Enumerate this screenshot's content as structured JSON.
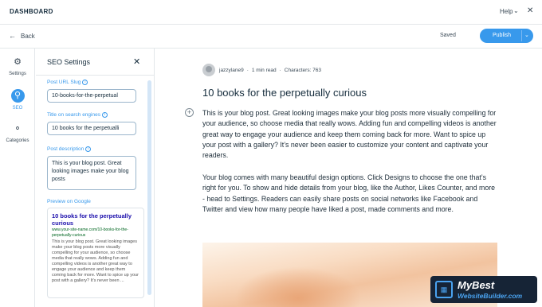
{
  "topbar": {
    "title": "DASHBOARD",
    "help": "Help"
  },
  "secondbar": {
    "back": "Back",
    "saved": "Saved",
    "publish": "Publish"
  },
  "rail": {
    "settings": "Settings",
    "seo": "SEO",
    "categories": "Categories"
  },
  "seo_panel": {
    "title": "SEO Settings",
    "url_slug_label": "Post URL Slug",
    "url_slug_value": "10-books-for-the-perpetual",
    "search_title_label": "Title on search engines",
    "search_title_value": "10 books for the perpetualli",
    "description_label": "Post description",
    "description_value": "This is your blog post. Great looking images make your blog posts",
    "preview_label": "Preview on Google",
    "preview_title": "10 books for the perpetually curious",
    "preview_url": "www.your-site-name.com/10-books-for-the-perpetually-curious",
    "preview_desc": "This is your blog post. Great looking images make your blog posts more visually compelling for your audience, so choose media that really wows. Adding fun and compelling videos is another great way to engage your audience and keep them coming back for more. Want to spice up your post with a gallery? It's never been ..."
  },
  "post": {
    "author": "jazzylane9",
    "read_time": "1 min read",
    "characters": "Characters: 763",
    "title": "10 books for the perpetually curious",
    "paragraph1": "This is your blog post. Great looking images make your blog posts more visually compelling for your audience, so choose media that really wows. Adding fun and compelling videos is another great way to engage your audience and keep them coming back for more. Want to spice up your post with a gallery? It’s never been easier to customize your content and captivate your readers.",
    "paragraph2": "Your blog comes with many beautiful design options. Click Designs to choose the one that’s right for you. To show and hide details from your blog, like the Author, Likes Counter, and more - head to Settings. Readers can easily share posts on social networks like Facebook and Twitter and view how many people have liked a post, made comments and more."
  },
  "badge": {
    "line1": "MyBest",
    "line2": "WebsiteBuilder.com"
  },
  "colors": {
    "accent": "#3899ec",
    "text": "#162d3d"
  },
  "icons": [
    "gear-icon",
    "search-icon",
    "categories-icon",
    "close-icon",
    "info-icon",
    "plus-icon",
    "chevron-down-icon",
    "back-arrow-icon"
  ]
}
